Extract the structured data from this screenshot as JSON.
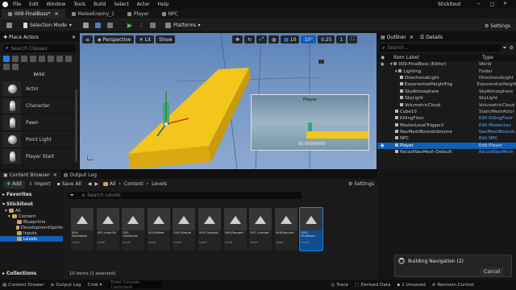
{
  "menu": [
    "File",
    "Edit",
    "Window",
    "Tools",
    "Build",
    "Select",
    "Actor",
    "Help"
  ],
  "window_title": "Stickitout",
  "tabs": [
    {
      "label": "009-FinalBoss*",
      "active": true
    },
    {
      "label": "MeleeEnemy_1",
      "active": false
    },
    {
      "label": "Player",
      "active": false
    },
    {
      "label": "NPC",
      "active": false
    }
  ],
  "toolbar": {
    "save_mode": "Selection Mode",
    "platforms": "Platforms",
    "settings": "Settings"
  },
  "place_actors": {
    "title": "Place Actors",
    "search_placeholder": "Search Classes",
    "category": "BASIC",
    "items": [
      "Actor",
      "Character",
      "Pawn",
      "Point Light",
      "Player Start"
    ]
  },
  "viewport": {
    "perspective": "Perspective",
    "lit": "Lit",
    "show": "Show",
    "snap": "10",
    "angle": "10°",
    "scale": "0.25",
    "cam": "1",
    "pip_title": "Player",
    "pip_time": "00.00000000"
  },
  "outliner": {
    "title": "Outliner",
    "details": "Details",
    "search_placeholder": "Search...",
    "col_label": "Item Label",
    "col_type": "Type",
    "rows": [
      {
        "name": "009-FinalBoss (Editor)",
        "type": "World",
        "indent": 1,
        "selected": false
      },
      {
        "name": "Lighting",
        "type": "Folder",
        "indent": 2,
        "selected": false
      },
      {
        "name": "DirectionalLight",
        "type": "DirectionalLight",
        "indent": 3,
        "selected": false
      },
      {
        "name": "ExponentialHeightFog",
        "type": "ExponentialHeight",
        "indent": 3,
        "selected": false
      },
      {
        "name": "SkyAtmosphere",
        "type": "SkyAtmosphere",
        "indent": 3,
        "selected": false
      },
      {
        "name": "SkyLight",
        "type": "SkyLight",
        "indent": 3,
        "selected": false
      },
      {
        "name": "VolumetricCloud",
        "type": "VolumetricCloud",
        "indent": 3,
        "selected": false
      },
      {
        "name": "Cube10",
        "type": "StaticMeshActor",
        "indent": 2,
        "selected": false
      },
      {
        "name": "KillingFloor",
        "type": "Edit KillingFloor",
        "indent": 2,
        "selected": false
      },
      {
        "name": "MasterLevelTrigger2",
        "type": "Edit MasterLev",
        "indent": 2,
        "selected": false
      },
      {
        "name": "NavMeshBoundsVolume",
        "type": "NavMeshBounds",
        "indent": 2,
        "selected": false
      },
      {
        "name": "NPC",
        "type": "Edit NPC",
        "indent": 2,
        "selected": false
      },
      {
        "name": "Player",
        "type": "Edit Player",
        "indent": 2,
        "selected": true
      },
      {
        "name": "RecastNavMesh-Default",
        "type": "RecastNavMesh",
        "indent": 2,
        "selected": false
      }
    ]
  },
  "content_browser": {
    "tab": "Content Browser",
    "tab2": "Output Log",
    "add": "Add",
    "import": "Import",
    "save_all": "Save All",
    "path": [
      "All",
      "Content",
      "Levels"
    ],
    "settings": "Settings",
    "search_placeholder": "Search Levels",
    "favorites": "Favorites",
    "project": "Stickitout",
    "tree": [
      "All",
      "Content",
      "Blueprints",
      "DevelopmentSprite",
      "Inputs",
      "Levels"
    ],
    "collections": "Collections",
    "status": "10 items (1 selected)",
    "tiles": [
      {
        "name": "000-Developer",
        "type": "Level"
      },
      {
        "name": "001-LearnTo",
        "type": "Level"
      },
      {
        "name": "002-Obstacles",
        "type": "Level"
      },
      {
        "name": "003-Melee",
        "type": "Level"
      },
      {
        "name": "004-Simple",
        "type": "Level"
      },
      {
        "name": "005-Combat",
        "type": "Level"
      },
      {
        "name": "006-Ranged",
        "type": "Level"
      },
      {
        "name": "007-Combat",
        "type": "Level"
      },
      {
        "name": "008-Beyond",
        "type": "Level"
      },
      {
        "name": "009-FinalBoss",
        "type": "Level",
        "selected": true
      }
    ]
  },
  "status_bar": {
    "content_drawer": "Content Drawer",
    "output_log": "Output Log",
    "cmd": "Cmd",
    "console_placeholder": "Enter Console Command",
    "trace": "Trace",
    "derived": "Derived Data",
    "unsaved": "1 Unsaved",
    "revision": "Revision Control"
  },
  "toast": {
    "text": "Building Navigation (2)",
    "cancel": "Cancel"
  },
  "colors": {
    "accent": "#0e5fb8",
    "platform": "#f5c518",
    "link": "#5fa8ff"
  }
}
